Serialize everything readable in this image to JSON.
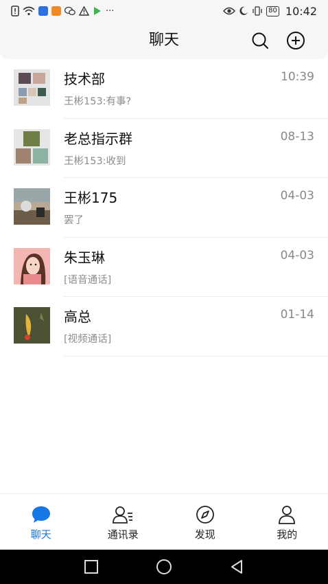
{
  "status_bar": {
    "time": "10:42",
    "battery": "80",
    "more": "···",
    "icons": [
      "alert-icon",
      "wifi-icon",
      "bulb-app-icon",
      "video-app-icon",
      "wechat-icon",
      "warning-icon",
      "play-app-icon",
      "eye-icon",
      "moon-icon",
      "vibrate-icon",
      "battery-icon"
    ]
  },
  "header": {
    "title": "聊天",
    "search_icon": "search-icon",
    "add_icon": "plus-circle-icon"
  },
  "chats": [
    {
      "name": "技术部",
      "time": "10:39",
      "preview": "王彬153:有事?"
    },
    {
      "name": "老总指示群",
      "time": "08-13",
      "preview": "王彬153:收到"
    },
    {
      "name": "王彬175",
      "time": "04-03",
      "preview": "罢了"
    },
    {
      "name": "朱玉琳",
      "time": "04-03",
      "preview": "[语音通话]"
    },
    {
      "name": "高总",
      "time": "01-14",
      "preview": "[视频通话]"
    }
  ],
  "nav": [
    {
      "label": "聊天",
      "icon": "chat-bubble-icon",
      "active": true
    },
    {
      "label": "通讯录",
      "icon": "contacts-icon",
      "active": false
    },
    {
      "label": "发现",
      "icon": "compass-icon",
      "active": false
    },
    {
      "label": "我的",
      "icon": "person-icon",
      "active": false
    }
  ],
  "colors": {
    "accent": "#1677e6",
    "muted": "#8c8c8c",
    "bar_bg": "#f6f6f6"
  }
}
